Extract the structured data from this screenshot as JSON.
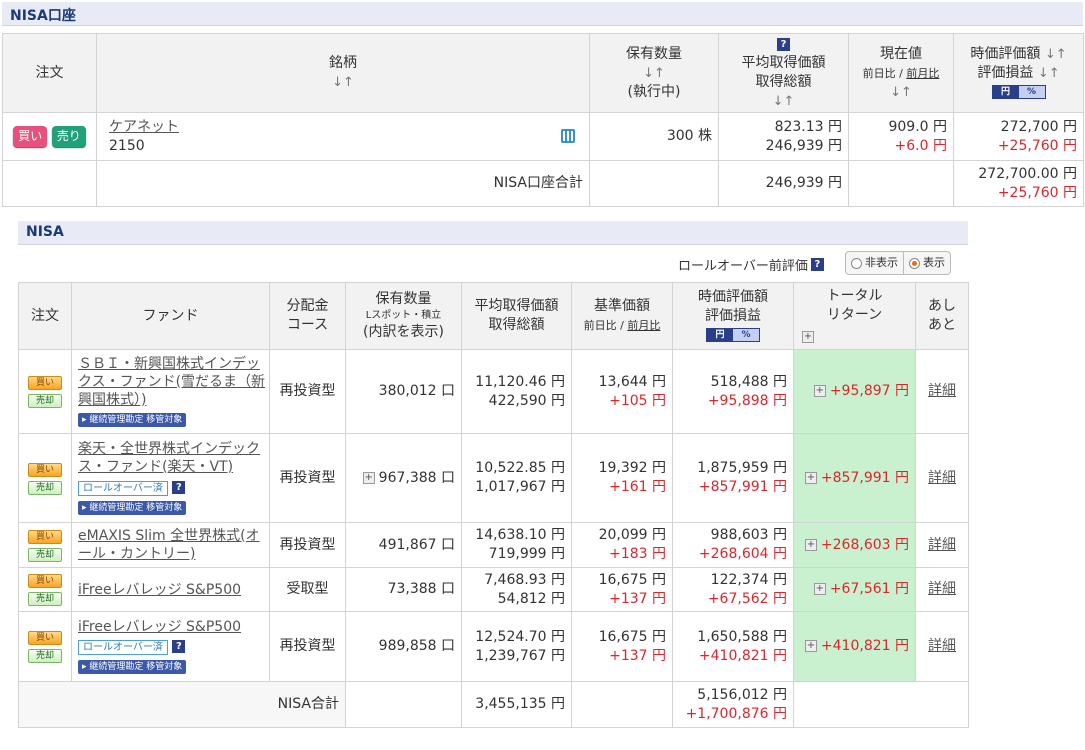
{
  "nisa_account": {
    "title": "NISA口座",
    "headers": {
      "order": "注文",
      "stock": "銘柄",
      "qty": "保有数量",
      "qty_sub": "(執行中)",
      "avg": "平均取得価額",
      "total_cost": "取得総額",
      "current": "現在値",
      "prev_day": "前日比",
      "prev_month": "前月比",
      "valuation": "時価評価額",
      "pl": "評価損益",
      "yen": "円",
      "pct": "%"
    },
    "buy": "買い",
    "sell": "売り",
    "row": {
      "name": "ケアネット",
      "code": "2150",
      "qty": "300 株",
      "avg": "823.13 円",
      "total_cost": "246,939 円",
      "current": "909.0 円",
      "change": "+6.0 円",
      "valuation": "272,700 円",
      "pl": "+25,760 円"
    },
    "total": {
      "label": "NISA口座合計",
      "total_cost": "246,939 円",
      "valuation": "272,700.00 円",
      "pl": "+25,760 円"
    }
  },
  "nisa": {
    "title": "NISA",
    "rollover_label": "ロールオーバー前評価",
    "toggle_hide": "非表示",
    "toggle_show": "表示",
    "headers": {
      "order": "注文",
      "fund": "ファンド",
      "course1": "分配金",
      "course2": "コース",
      "qty": "保有数量",
      "qty_sub": "Lスポット・積立",
      "qty_link": "(内訳を表示)",
      "avg": "平均取得価額",
      "total_cost": "取得総額",
      "nav": "基準価額",
      "prev_day": "前日比",
      "prev_month": "前月比",
      "valuation": "時価評価額",
      "pl": "評価損益",
      "yen": "円",
      "pct": "%",
      "total_return1": "トータル",
      "total_return2": "リターン",
      "ashiato1": "あし",
      "ashiato2": "あと"
    },
    "buy": "買い",
    "sell": "売却",
    "tag_transfer": "▸ 継続管理勘定 移管対象",
    "tag_rollover": "ロールオーバー済",
    "detail": "詳細",
    "rows": [
      {
        "name": "ＳＢＩ・新興国株式インデックス・ファンド(雪だるま（新興国株式）)",
        "course": "再投資型",
        "qty": "380,012 口",
        "avg": "11,120.46 円",
        "total_cost": "422,590 円",
        "nav": "13,644 円",
        "change": "+105 円",
        "valuation": "518,488 円",
        "pl": "+95,898 円",
        "total_return": "+95,897 円"
      },
      {
        "name": "楽天・全世界株式インデックス・ファンド(楽天・VT)",
        "course": "再投資型",
        "qty": "967,388 口",
        "avg": "10,522.85 円",
        "total_cost": "1,017,967 円",
        "nav": "19,392 円",
        "change": "+161 円",
        "valuation": "1,875,959 円",
        "pl": "+857,991 円",
        "total_return": "+857,991 円"
      },
      {
        "name": "eMAXIS Slim 全世界株式(オール・カントリー)",
        "course": "再投資型",
        "qty": "491,867 口",
        "avg": "14,638.10 円",
        "total_cost": "719,999 円",
        "nav": "20,099 円",
        "change": "+183 円",
        "valuation": "988,603 円",
        "pl": "+268,604 円",
        "total_return": "+268,603 円"
      },
      {
        "name": "iFreeレバレッジ S&P500",
        "course": "受取型",
        "qty": "73,388 口",
        "avg": "7,468.93 円",
        "total_cost": "54,812 円",
        "nav": "16,675 円",
        "change": "+137 円",
        "valuation": "122,374 円",
        "pl": "+67,562 円",
        "total_return": "+67,561 円"
      },
      {
        "name": "iFreeレバレッジ S&P500",
        "course": "再投資型",
        "qty": "989,858 口",
        "avg": "12,524.70 円",
        "total_cost": "1,239,767 円",
        "nav": "16,675 円",
        "change": "+137 円",
        "valuation": "1,650,588 円",
        "pl": "+410,821 円",
        "total_return": "+410,821 円"
      }
    ],
    "total": {
      "label": "NISA合計",
      "total_cost": "3,455,135 円",
      "valuation": "5,156,012 円",
      "pl": "+1,700,876 円"
    }
  }
}
